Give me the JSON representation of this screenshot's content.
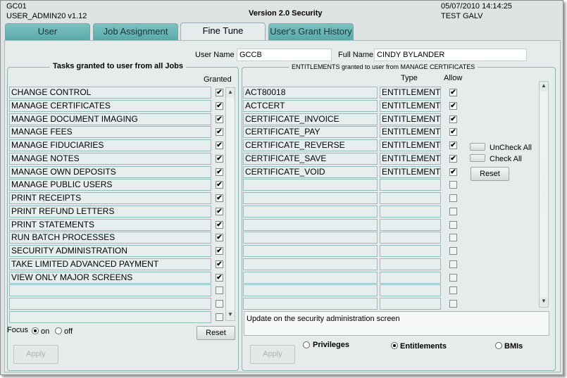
{
  "header": {
    "code": "GC01",
    "user": "USER_ADMIN20 v1.12",
    "title": "Version 2.0 Security",
    "datetime": "05/07/2010 14:14:25",
    "env": "TEST GALV"
  },
  "tabs": [
    {
      "label": "User"
    },
    {
      "label": "Job Assignment"
    },
    {
      "label": "Fine Tune"
    },
    {
      "label": "User's Grant History"
    }
  ],
  "form": {
    "user_name_label": "User Name",
    "user_name_value": "GCCB",
    "full_name_label": "Full Name",
    "full_name_value": "CINDY BYLANDER"
  },
  "tasks": {
    "title": "Tasks granted to user from all Jobs",
    "granted_header": "Granted",
    "rows": [
      {
        "label": "CHANGE CONTROL",
        "granted": true
      },
      {
        "label": "MANAGE CERTIFICATES",
        "granted": true
      },
      {
        "label": "MANAGE DOCUMENT IMAGING",
        "granted": true
      },
      {
        "label": "MANAGE FEES",
        "granted": true
      },
      {
        "label": "MANAGE FIDUCIARIES",
        "granted": true
      },
      {
        "label": "MANAGE NOTES",
        "granted": true
      },
      {
        "label": "MANAGE OWN DEPOSITS",
        "granted": true
      },
      {
        "label": "MANAGE PUBLIC USERS",
        "granted": true
      },
      {
        "label": "PRINT RECEIPTS",
        "granted": true
      },
      {
        "label": "PRINT REFUND LETTERS",
        "granted": true
      },
      {
        "label": "PRINT STATEMENTS",
        "granted": true
      },
      {
        "label": "RUN BATCH PROCESSES",
        "granted": true
      },
      {
        "label": "SECURITY ADMINISTRATION",
        "granted": true
      },
      {
        "label": "TAKE LIMITED ADVANCED PAYMENT",
        "granted": true
      },
      {
        "label": "VIEW ONLY MAJOR SCREENS",
        "granted": true
      },
      {
        "label": "",
        "granted": false
      },
      {
        "label": "",
        "granted": false
      },
      {
        "label": "",
        "granted": false
      }
    ],
    "focus_label": "Focus",
    "focus_on": "on",
    "focus_off": "off",
    "reset": "Reset",
    "apply": "Apply"
  },
  "entitlements": {
    "title": "ENTITLEMENTS granted to user from MANAGE CERTIFICATES",
    "type_header": "Type",
    "allow_header": "Allow",
    "rows": [
      {
        "name": "ACT80018",
        "type": "ENTITLEMENT",
        "allow": true
      },
      {
        "name": "ACTCERT",
        "type": "ENTITLEMENT",
        "allow": true
      },
      {
        "name": "CERTIFICATE_INVOICE",
        "type": "ENTITLEMENT",
        "allow": true
      },
      {
        "name": "CERTIFICATE_PAY",
        "type": "ENTITLEMENT",
        "allow": true
      },
      {
        "name": "CERTIFICATE_REVERSE",
        "type": "ENTITLEMENT",
        "allow": true
      },
      {
        "name": "CERTIFICATE_SAVE",
        "type": "ENTITLEMENT",
        "allow": true
      },
      {
        "name": "CERTIFICATE_VOID",
        "type": "ENTITLEMENT",
        "allow": true
      },
      {
        "name": "",
        "type": "",
        "allow": false
      },
      {
        "name": "",
        "type": "",
        "allow": false
      },
      {
        "name": "",
        "type": "",
        "allow": false
      },
      {
        "name": "",
        "type": "",
        "allow": false
      },
      {
        "name": "",
        "type": "",
        "allow": false
      },
      {
        "name": "",
        "type": "",
        "allow": false
      },
      {
        "name": "",
        "type": "",
        "allow": false
      },
      {
        "name": "",
        "type": "",
        "allow": false
      },
      {
        "name": "",
        "type": "",
        "allow": false
      },
      {
        "name": "",
        "type": "",
        "allow": false
      }
    ],
    "uncheck_all": "UnCheck All",
    "check_all": "Check All",
    "reset": "Reset",
    "description": "Update on the security administration screen",
    "apply": "Apply",
    "modes": [
      {
        "label": "Privileges",
        "selected": false
      },
      {
        "label": "Entitlements",
        "selected": true
      },
      {
        "label": "BMIs",
        "selected": false
      }
    ]
  }
}
